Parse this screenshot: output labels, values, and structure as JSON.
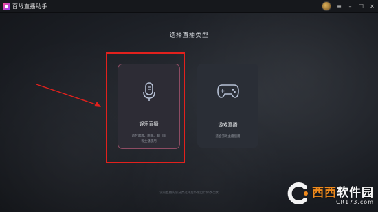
{
  "titlebar": {
    "app_title": "百战直播助手",
    "controls": {
      "menu": "≡",
      "minimize": "–",
      "maximize": "☐",
      "close": "✕"
    }
  },
  "main": {
    "heading": "选择直播类型",
    "cards": [
      {
        "label": "娱乐直播",
        "desc_line1": "适合唱歌、跳舞、聊门等",
        "desc_line2": "等主播使用",
        "icon": "microphone-icon",
        "selected": true
      },
      {
        "label": "游戏直播",
        "desc_line1": "适合游戏主播使用",
        "icon": "gamepad-icon",
        "selected": false
      }
    ],
    "footer_note": "说的直播内容分类选择后不能自行修改次数"
  },
  "watermark": {
    "text_main": "软件园",
    "text_accent": "西西",
    "url": "CR173.com"
  },
  "colors": {
    "highlight": "#e2211d",
    "card_border": "#8e4c63",
    "accent": "#f08a1c"
  }
}
